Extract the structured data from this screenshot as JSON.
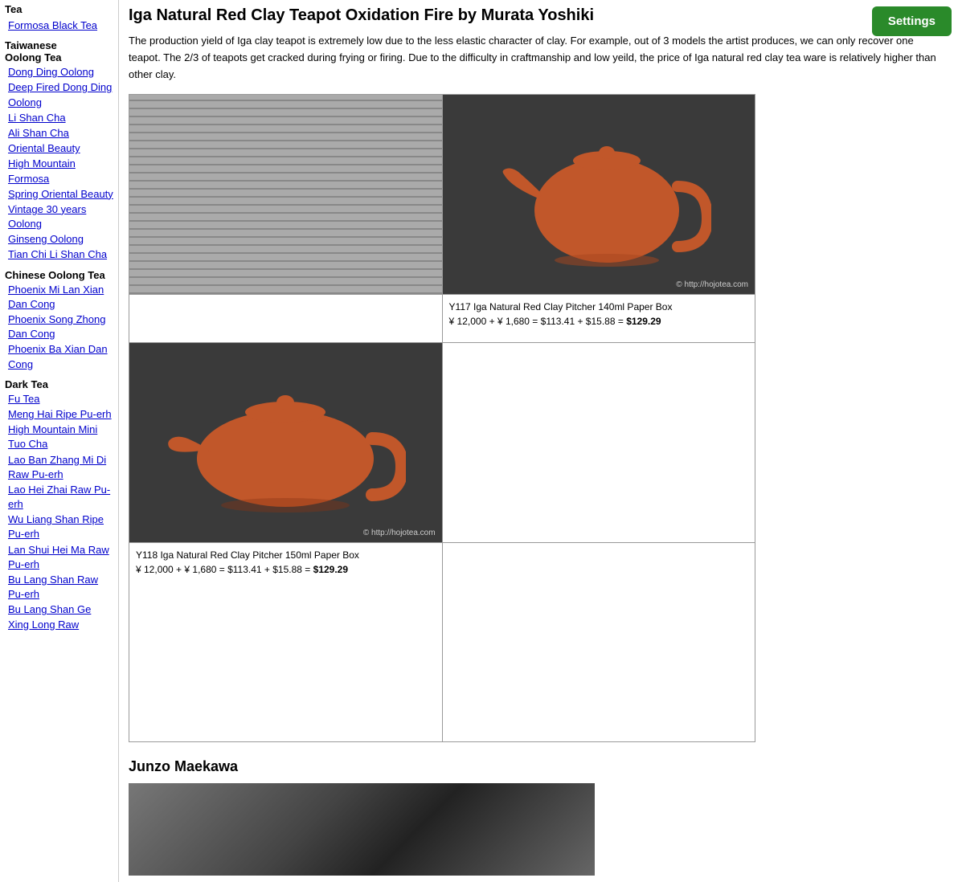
{
  "sidebar": {
    "top_category": "Tea",
    "links": [
      {
        "id": "formosa-black-tea",
        "label": "Formosa Black Tea"
      },
      {
        "id": "taiwanese-oolong-tea",
        "label": "Taiwanese Oolong Tea",
        "isCategory": true
      },
      {
        "id": "dong-ding-oolong",
        "label": "Dong Ding Oolong"
      },
      {
        "id": "deep-fired-dong-ding-oolong",
        "label": "Deep Fired Dong Ding Oolong"
      },
      {
        "id": "li-shan-cha",
        "label": "Li Shan Cha"
      },
      {
        "id": "ali-shan-cha",
        "label": "Ali Shan Cha"
      },
      {
        "id": "oriental-beauty",
        "label": "Oriental Beauty"
      },
      {
        "id": "high-mountain-formosa",
        "label": "High Mountain Formosa"
      },
      {
        "id": "spring-oriental-beauty",
        "label": "Spring Oriental Beauty"
      },
      {
        "id": "vintage-30-years-oolong",
        "label": "Vintage 30 years Oolong"
      },
      {
        "id": "ginseng-oolong",
        "label": "Ginseng Oolong"
      },
      {
        "id": "tian-chi-li-shan-cha",
        "label": "Tian Chi Li Shan Cha"
      },
      {
        "id": "chinese-oolong-tea",
        "label": "Chinese Oolong Tea",
        "isCategory": true
      },
      {
        "id": "phoenix-mi-lan-xian-dan-cong",
        "label": "Phoenix Mi Lan Xian Dan Cong"
      },
      {
        "id": "phoenix-song-zhong-dan-cong",
        "label": "Phoenix Song Zhong Dan Cong"
      },
      {
        "id": "phoenix-ba-xian-dan-cong",
        "label": "Phoenix Ba Xian Dan Cong"
      },
      {
        "id": "dark-tea",
        "label": "Dark Tea",
        "isCategory": true
      },
      {
        "id": "fu-tea",
        "label": "Fu Tea"
      },
      {
        "id": "meng-hai-ripe-pu-erh",
        "label": "Meng Hai Ripe Pu-erh"
      },
      {
        "id": "high-mountain-mini-tuo-cha",
        "label": "High Mountain Mini Tuo Cha"
      },
      {
        "id": "lao-ban-zhang-mi-di-raw-pu-erh",
        "label": "Lao Ban Zhang Mi Di Raw Pu-erh"
      },
      {
        "id": "lao-hei-zhai-raw-pu-erh",
        "label": "Lao Hei Zhai Raw Pu-erh"
      },
      {
        "id": "wu-liang-shan-ripe-pu-erh",
        "label": "Wu Liang Shan Ripe Pu-erh"
      },
      {
        "id": "lan-shui-hei-ma-raw-pu-erh",
        "label": "Lan Shui Hei Ma Raw Pu-erh"
      },
      {
        "id": "bu-lang-shan-raw-pu-erh",
        "label": "Bu Lang Shan Raw Pu-erh"
      },
      {
        "id": "bu-lang-shan-ge-xing-long-raw",
        "label": "Bu Lang Shan Ge Xing Long Raw"
      }
    ]
  },
  "main": {
    "title": "Iga Natural Red Clay Teapot Oxidation Fire by Murata Yoshiki",
    "description": "The production yield of Iga clay teapot is extremely low due to the less elastic character of clay. For example, out of 3 models the artist produces, we can only recover one teapot. The 2/3 of teapots get cracked during frying or firing. Due to the difficulty in craftmanship and low yeild, the price of Iga natural red clay tea ware is relatively higher than other clay.",
    "settings_label": "Settings",
    "products": [
      {
        "id": "y117",
        "caption_line1": "Y117 Iga Natural Red Clay Pitcher 140ml Paper Box",
        "caption_line2": "¥ 12,000 + ¥ 1,680 = $113.41 + $15.88 =",
        "price": "$129.29"
      },
      {
        "id": "y118",
        "caption_line1": "Y118 Iga Natural Red Clay Pitcher 150ml Paper Box",
        "caption_line2": "¥ 12,000 + ¥ 1,680 = $113.41 + $15.88 =",
        "price": "$129.29"
      }
    ],
    "copyright_text": "© http://hojotea.com",
    "junzo_title": "Junzo Maekawa"
  }
}
